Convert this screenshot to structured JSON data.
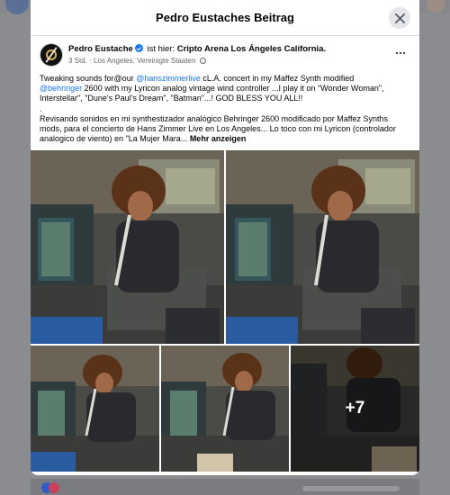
{
  "modal": {
    "title": "Pedro Eustaches Beitrag"
  },
  "post": {
    "author": "Pedro Eustache",
    "is_here": "ist hier:",
    "location": "Cripto Arena Los Ángeles California",
    "time": "3 Std.",
    "place": "Los Angeles, Vereinigte Staaten",
    "text": {
      "line1_a": "Tweaking sounds for@our ",
      "mention_hanszimmer": "@hanszimmerlive",
      "line1_b": "  cL.A. concert in my Maffez Synth modified",
      "mention_behringer": "@behringer",
      "line2_b": " 2600 with my Lyricon analog vintage wind controller ...I play it on \"Wonder Woman\", Interstellar\", \"Dune's Paul's Dream\", \"Batman\"...! GOD BLESS YOU ALL!!",
      "dot": ".",
      "spanish": "Revisando sonidos en mi synthestizador analógico Behringer 2600 modificado por Maffez Synths mods, para el concierto de Hans Zimmer Live en Los Angeles... Lo toco con mi Lyricon (controlador analogico de viento) en \"La Mujer Mara...",
      "see_more": "Mehr anzeigen"
    },
    "more_photos": "+7"
  },
  "icons": {
    "close": "close-icon",
    "more": "more-horizontal-icon",
    "verified": "verified-badge-icon",
    "globe": "globe-icon"
  },
  "colors": {
    "link": "#1877f2",
    "verified": "#1877f2",
    "secondary_text": "#65676b"
  }
}
